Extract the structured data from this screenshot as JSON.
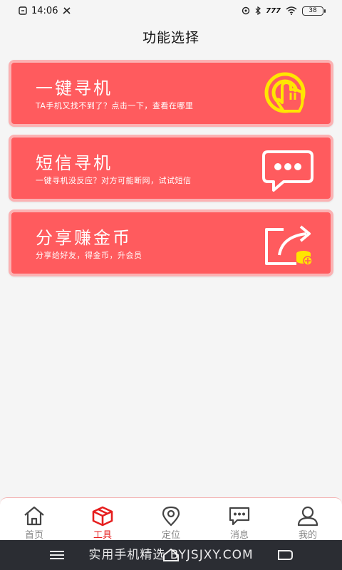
{
  "status": {
    "time": "14:06",
    "network": "777",
    "battery": "38"
  },
  "header": {
    "title": "功能选择"
  },
  "cards": [
    {
      "title": "一键寻机",
      "subtitle": "TA手机又找不到了？点击一下，查看在哪里",
      "icon": "tap-hand-icon"
    },
    {
      "title": "短信寻机",
      "subtitle": "一键寻机没反应？对方可能断网，试试短信",
      "icon": "message-bubble-icon"
    },
    {
      "title": "分享赚金币",
      "subtitle": "分享给好友，得金币，升会员",
      "icon": "share-coins-icon"
    }
  ],
  "bottom_nav": [
    {
      "label": "首页",
      "icon": "home-icon",
      "active": false
    },
    {
      "label": "工具",
      "icon": "toolbox-icon",
      "active": true
    },
    {
      "label": "定位",
      "icon": "location-pin-icon",
      "active": false
    },
    {
      "label": "消息",
      "icon": "chat-icon",
      "active": false
    },
    {
      "label": "我的",
      "icon": "user-icon",
      "active": false
    }
  ],
  "watermark": "实用手机精选 BYJSJXY.COM",
  "colors": {
    "card": "#ff5b5e",
    "card_border": "#fbb2b3",
    "active": "#e61e1e",
    "icon_yellow": "#ffe600"
  }
}
